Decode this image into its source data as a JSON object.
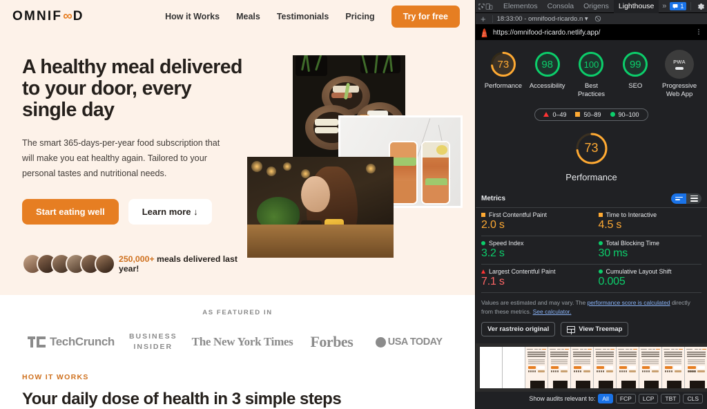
{
  "site": {
    "logo": {
      "pre": "OMNIF",
      "infinity": "∞",
      "post": "D"
    },
    "nav": [
      {
        "label": "How it Works"
      },
      {
        "label": "Meals"
      },
      {
        "label": "Testimonials"
      },
      {
        "label": "Pricing"
      }
    ],
    "cta_header": "Try for free",
    "hero": {
      "heading": "A healthy meal delivered to your door, every single day",
      "paragraph": "The smart 365-days-per-year food subscription that will make you eat healthy again. Tailored to your personal tastes and nutritional needs.",
      "primary_btn": "Start eating well",
      "secondary_btn": "Learn more ↓",
      "delivered_count": "250,000+",
      "delivered_text": " meals delivered last year!"
    },
    "featured": {
      "label": "AS FEATURED IN",
      "logos": [
        {
          "name": "TechCrunch",
          "text": "TechCrunch"
        },
        {
          "name": "Business Insider",
          "line1": "BUSINESS",
          "line2": "INSIDER"
        },
        {
          "name": "The New York Times",
          "text": "The New York Times"
        },
        {
          "name": "Forbes",
          "text": "Forbes"
        },
        {
          "name": "USA Today",
          "text": "USA TODAY"
        }
      ]
    },
    "how": {
      "eyebrow": "HOW IT WORKS",
      "title": "Your daily dose of health in 3 simple steps"
    }
  },
  "devtools": {
    "tabs": [
      {
        "label": "Elementos",
        "active": false
      },
      {
        "label": "Consola",
        "active": false
      },
      {
        "label": "Origens",
        "active": false
      },
      {
        "label": "Lighthouse",
        "active": true
      }
    ],
    "more_tabs": "»",
    "message_count": "1",
    "subbar": {
      "run": "18:33:00 - omnifood-ricardo.n",
      "caret": "▾"
    },
    "url": "https://omnifood-ricardo.netlify.app/",
    "gauges": [
      {
        "label": "Performance",
        "score": 73,
        "color": "#fa3"
      },
      {
        "label": "Accessibility",
        "score": 98,
        "color": "#0cce6b"
      },
      {
        "label": "Best Practices",
        "score": 100,
        "color": "#0cce6b"
      },
      {
        "label": "SEO",
        "score": 99,
        "color": "#0cce6b"
      }
    ],
    "pwa": {
      "label": "Progressive Web App",
      "badge": "PWA"
    },
    "legend": [
      {
        "range": "0–49",
        "shape": "triangle"
      },
      {
        "range": "50–89",
        "shape": "square"
      },
      {
        "range": "90–100",
        "shape": "circle"
      }
    ],
    "big_gauge": {
      "score": 73,
      "label": "Performance",
      "color": "#fa3"
    },
    "metrics_title": "Metrics",
    "metrics": [
      {
        "name": "First Contentful Paint",
        "value": "2.0 s",
        "status": "average",
        "color": "#fa3"
      },
      {
        "name": "Time to Interactive",
        "value": "4.5 s",
        "status": "average",
        "color": "#fa3"
      },
      {
        "name": "Speed Index",
        "value": "3.2 s",
        "status": "good",
        "color": "#0cce6b"
      },
      {
        "name": "Total Blocking Time",
        "value": "30 ms",
        "status": "good",
        "color": "#0cce6b"
      },
      {
        "name": "Largest Contentful Paint",
        "value": "7.1 s",
        "status": "poor",
        "color": "#f66"
      },
      {
        "name": "Cumulative Layout Shift",
        "value": "0.005",
        "status": "good",
        "color": "#0cce6b"
      }
    ],
    "note": {
      "part1": "Values are estimated and may vary. The ",
      "link1": "performance score is calculated",
      "part2": " directly from these metrics. ",
      "link2": "See calculator."
    },
    "actions": [
      {
        "label": "Ver rastreio original"
      },
      {
        "label": "View Treemap"
      }
    ],
    "footer": {
      "label": "Show audits relevant to:",
      "filters": [
        {
          "label": "All",
          "active": true
        },
        {
          "label": "FCP",
          "active": false
        },
        {
          "label": "LCP",
          "active": false
        },
        {
          "label": "TBT",
          "active": false
        },
        {
          "label": "CLS",
          "active": false
        }
      ]
    }
  }
}
